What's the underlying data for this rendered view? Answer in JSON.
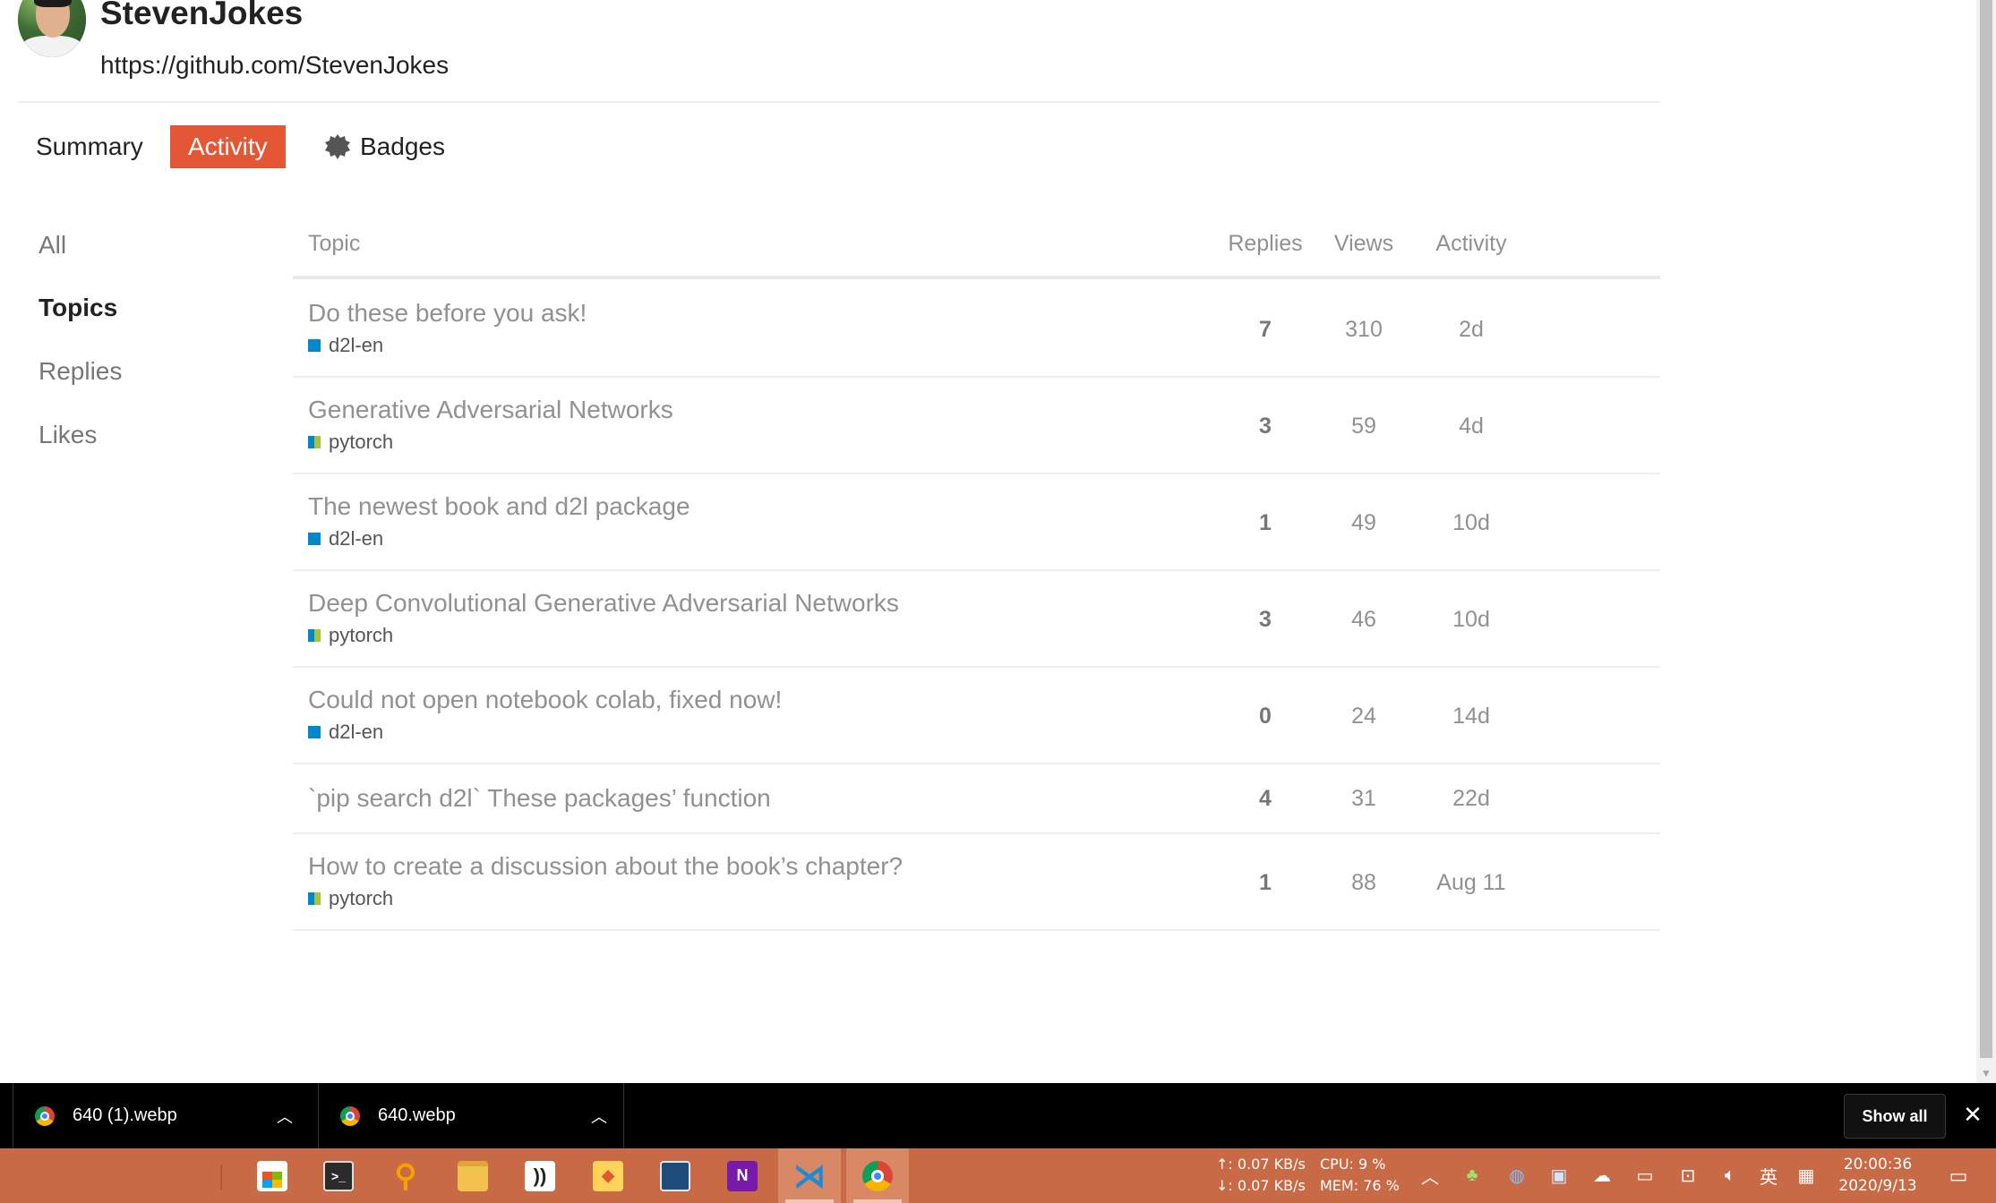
{
  "profile": {
    "username": "StevenJokes",
    "url": "https://github.com/StevenJokes"
  },
  "tabs": [
    {
      "label": "Summary",
      "active": false
    },
    {
      "label": "Activity",
      "active": true
    },
    {
      "label": "Badges",
      "active": false,
      "icon": "certificate-icon"
    }
  ],
  "nav": {
    "items": [
      {
        "label": "All",
        "active": false
      },
      {
        "label": "Topics",
        "active": true
      },
      {
        "label": "Replies",
        "active": false
      },
      {
        "label": "Likes",
        "active": false
      }
    ]
  },
  "table": {
    "headers": {
      "topic": "Topic",
      "replies": "Replies",
      "views": "Views",
      "activity": "Activity"
    },
    "rows": [
      {
        "title": "Do these before you ask!",
        "category": "d2l-en",
        "replies": "7",
        "views": "310",
        "activity": "2d"
      },
      {
        "title": "Generative Adversarial Networks",
        "category": "pytorch",
        "replies": "3",
        "views": "59",
        "activity": "4d"
      },
      {
        "title": "The newest book and d2l package",
        "category": "d2l-en",
        "replies": "1",
        "views": "49",
        "activity": "10d"
      },
      {
        "title": "Deep Convolutional Generative Adversarial Networks",
        "category": "pytorch",
        "replies": "3",
        "views": "46",
        "activity": "10d"
      },
      {
        "title": "Could not open notebook colab, fixed now!",
        "category": "d2l-en",
        "replies": "0",
        "views": "24",
        "activity": "14d"
      },
      {
        "title": "`pip search d2l` These packages’ function",
        "category": "",
        "replies": "4",
        "views": "31",
        "activity": "22d"
      },
      {
        "title": "How to create a discussion about the book’s chapter?",
        "category": "pytorch",
        "replies": "1",
        "views": "88",
        "activity": "Aug 11"
      }
    ]
  },
  "downloads": {
    "items": [
      {
        "filename": "640 (1).webp"
      },
      {
        "filename": "640.webp"
      }
    ],
    "show_all": "Show all"
  },
  "taskbar": {
    "net_up": "↑: 0.07 KB/s",
    "net_down": "↓: 0.07 KB/s",
    "cpu": "CPU:  9 %",
    "mem": "MEM: 76 %",
    "ime": "英",
    "time": "20:00:36",
    "date": "2020/9/13"
  },
  "colors": {
    "accent": "#e45735",
    "cat_d2l": "#0088cc",
    "cat_pytorch_secondary": "#a8c43a",
    "taskbar": "#c96a46"
  }
}
